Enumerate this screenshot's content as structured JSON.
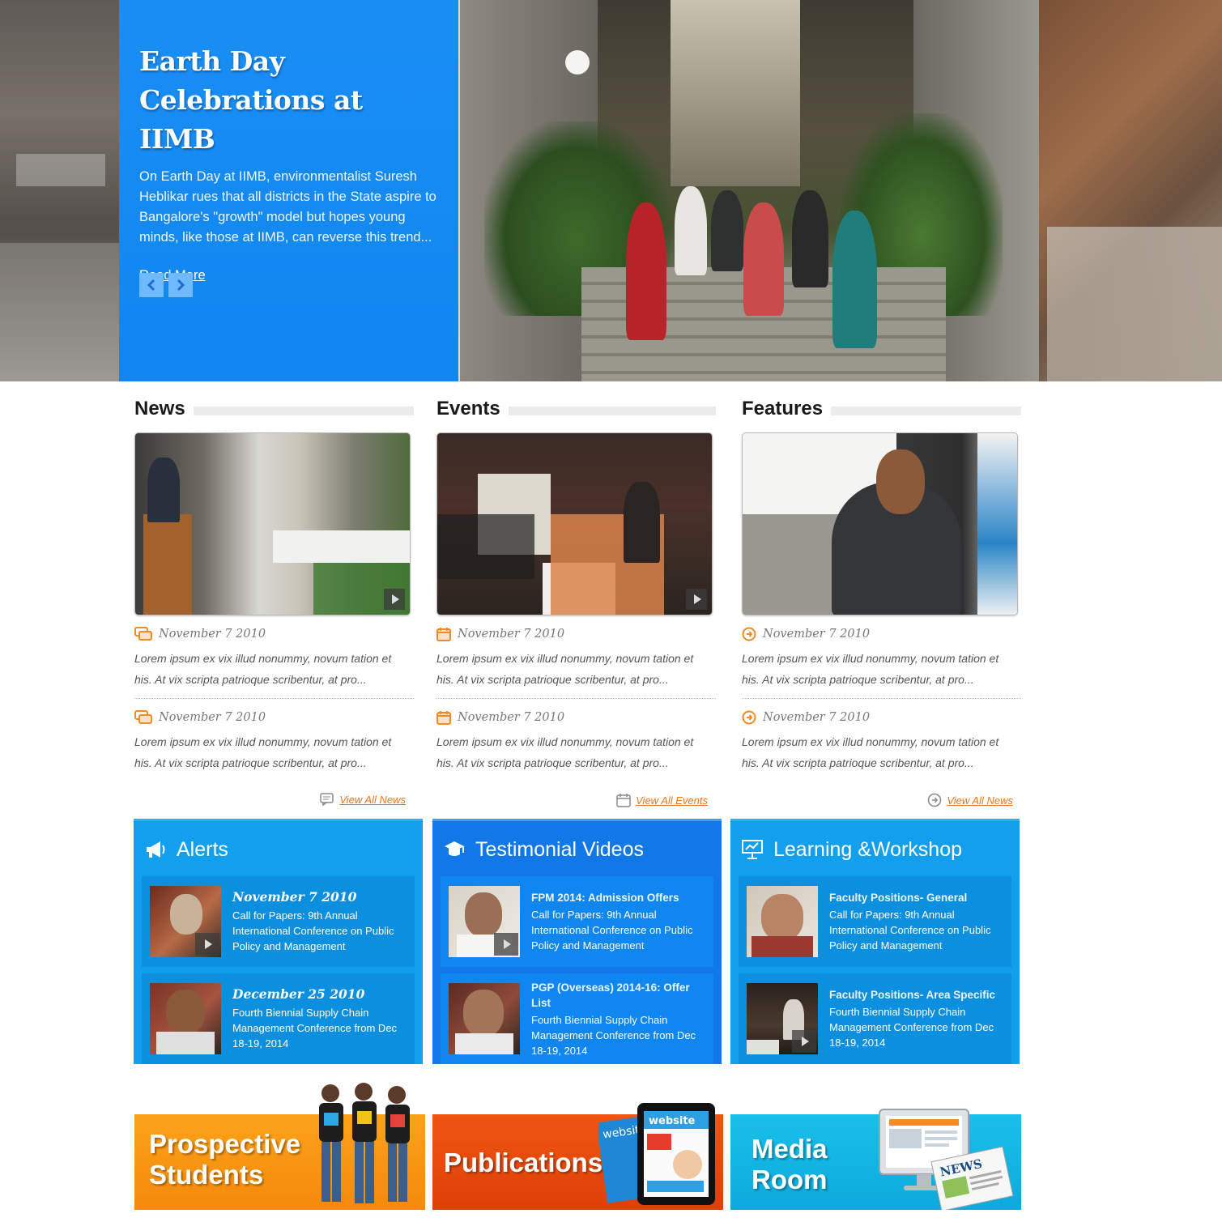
{
  "hero": {
    "title": "Earth Day Celebrations at IIMB",
    "text": "On Earth Day at IIMB, environmentalist Suresh Heblikar rues that all districts in the State aspire to Bangalore's \"growth\" model but hopes young minds, like those at IIMB, can reverse this trend...",
    "read_more": "Read More",
    "prev_icon": "chevron-left-icon",
    "next_icon": "chevron-right-icon",
    "accent": "#1a8ef5"
  },
  "columns": [
    {
      "title": "News",
      "icon": "chat-bubble-icon",
      "items": [
        {
          "date": "November 7 2010",
          "text": "Lorem ipsum ex vix illud nonummy, novum tation et his. At vix scripta patrioque scribentur, at pro..."
        },
        {
          "date": "November 7 2010",
          "text": "Lorem ipsum ex vix illud nonummy, novum tation et his. At vix scripta patrioque scribentur, at pro..."
        }
      ],
      "view_all": "View All News"
    },
    {
      "title": "Events",
      "icon": "calendar-icon",
      "items": [
        {
          "date": "November 7 2010",
          "text": "Lorem ipsum ex vix illud nonummy, novum tation et his. At vix scripta patrioque scribentur, at pro..."
        },
        {
          "date": "November 7 2010",
          "text": "Lorem ipsum ex vix illud nonummy, novum tation et his. At vix scripta patrioque scribentur, at pro..."
        }
      ],
      "view_all": "View All Events"
    },
    {
      "title": "Features",
      "icon": "arrow-circle-icon",
      "items": [
        {
          "date": "November 7 2010",
          "text": "Lorem ipsum ex vix illud nonummy, novum tation et his. At vix scripta patrioque scribentur, at pro..."
        },
        {
          "date": "November 7 2010",
          "text": "Lorem ipsum ex vix illud nonummy, novum tation et his. At vix scripta patrioque scribentur, at pro..."
        }
      ],
      "view_all": "View All News"
    }
  ],
  "boxes": [
    {
      "title": "Alerts",
      "icon": "megaphone-icon",
      "entries": [
        {
          "date": "November 7 2010",
          "text": "Call for Papers: 9th Annual International Conference on Public Policy and Management"
        },
        {
          "date": "December 25 2010",
          "text": "Fourth Biennial Supply Chain Management Conference from Dec 18-19, 2014"
        }
      ]
    },
    {
      "title": "Testimonial Videos",
      "icon": "graduation-cap-icon",
      "entries": [
        {
          "heading": "FPM 2014: Admission Offers",
          "text": "Call for Papers: 9th Annual International Conference on Public Policy and Management"
        },
        {
          "heading": "PGP (Overseas) 2014-16: Offer List",
          "text": "Fourth Biennial Supply Chain Management Conference from Dec 18-19, 2014"
        }
      ]
    },
    {
      "title": "Learning &Workshop",
      "icon": "presentation-icon",
      "entries": [
        {
          "heading": "Faculty Positions- General",
          "text": "Call for Papers: 9th Annual International Conference on Public Policy and Management"
        },
        {
          "heading": "Faculty Positions- Area Specific",
          "text": "Fourth Biennial Supply Chain Management Conference from Dec 18-19, 2014"
        }
      ]
    }
  ],
  "banners": [
    {
      "label": "Prospective Students",
      "line1": "Prospective",
      "line2": "Students",
      "color": "#f7930e"
    },
    {
      "label": "Publications",
      "color": "#e8490c",
      "magazine_text": "website"
    },
    {
      "label": "Media Room",
      "line1": "Media",
      "line2": "Room",
      "color": "#11b4e4",
      "news_text": "NEWS"
    }
  ]
}
